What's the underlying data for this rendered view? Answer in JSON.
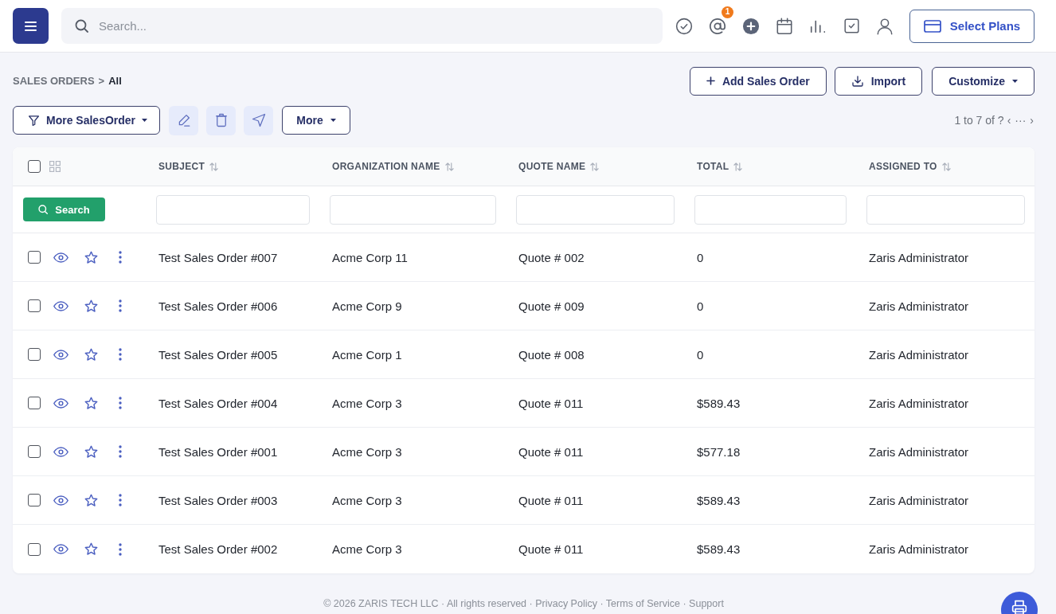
{
  "header": {
    "search": {
      "placeholder": "Search..."
    },
    "mention_badge": "1",
    "plan_button": "Select Plans"
  },
  "breadcrumb": {
    "separator": ">",
    "items": [
      {
        "label": "SALES ORDERS",
        "current": false
      },
      {
        "label": "All",
        "current": true
      }
    ]
  },
  "actions": [
    {
      "kind": "add",
      "label": "Add Sales Order"
    },
    {
      "kind": "import",
      "label": "Import"
    },
    {
      "kind": "menu",
      "label": "Customize"
    }
  ],
  "toolbar": {
    "filter_button": "More SalesOrder",
    "more_button": "More",
    "pagination": {
      "range": "1 to 7 of ?",
      "prev": "‹",
      "ellipsis": "···",
      "next": "›"
    }
  },
  "table": {
    "all_selected": false,
    "columns": [
      "SUBJECT",
      "ORGANIZATION NAME",
      "QUOTE NAME",
      "TOTAL",
      "ASSIGNED TO"
    ],
    "search_button": "Search",
    "rows": [
      {
        "selected": false,
        "starred": false,
        "cells": [
          "Test Sales Order #007",
          "Acme Corp 11",
          "Quote # 002",
          "0",
          "Zaris Administrator"
        ]
      },
      {
        "selected": false,
        "starred": false,
        "cells": [
          "Test Sales Order #006",
          "Acme Corp 9",
          "Quote # 009",
          "0",
          "Zaris Administrator"
        ]
      },
      {
        "selected": false,
        "starred": false,
        "cells": [
          "Test Sales Order #005",
          "Acme Corp 1",
          "Quote # 008",
          "0",
          "Zaris Administrator"
        ]
      },
      {
        "selected": false,
        "starred": false,
        "cells": [
          "Test Sales Order #004",
          "Acme Corp 3",
          "Quote # 011",
          "$589.43",
          "Zaris Administrator"
        ]
      },
      {
        "selected": false,
        "starred": false,
        "cells": [
          "Test Sales Order #001",
          "Acme Corp 3",
          "Quote # 011",
          "$577.18",
          "Zaris Administrator"
        ]
      },
      {
        "selected": false,
        "starred": false,
        "cells": [
          "Test Sales Order #003",
          "Acme Corp 3",
          "Quote # 011",
          "$589.43",
          "Zaris Administrator"
        ]
      },
      {
        "selected": false,
        "starred": false,
        "cells": [
          "Test Sales Order #002",
          "Acme Corp 3",
          "Quote # 011",
          "$589.43",
          "Zaris Administrator"
        ]
      }
    ]
  },
  "footer": {
    "notice": "© 2026 ZARIS TECH LLC · All rights reserved ·",
    "links": [
      {
        "label": "Privacy Policy",
        "after": "·"
      },
      {
        "label": "Terms of Service",
        "after": "·"
      },
      {
        "label": "Support"
      }
    ]
  }
}
